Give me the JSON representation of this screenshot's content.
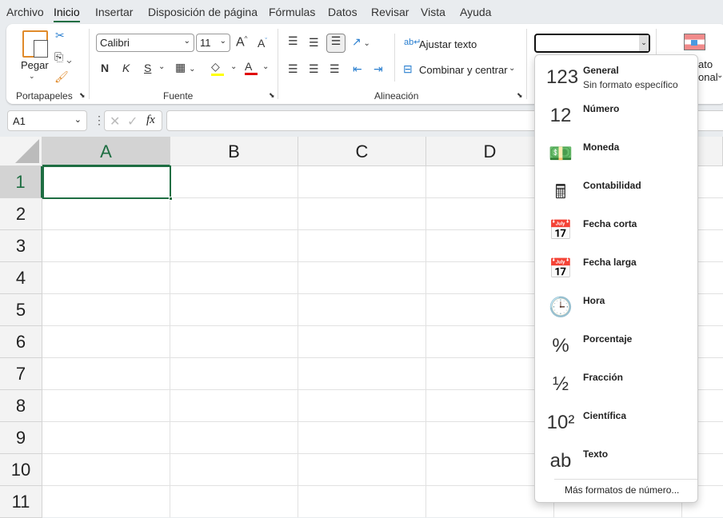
{
  "tabs": [
    "Archivo",
    "Inicio",
    "Insertar",
    "Disposición de página",
    "Fórmulas",
    "Datos",
    "Revisar",
    "Vista",
    "Ayuda"
  ],
  "active_tab": "Inicio",
  "clipboard": {
    "paste": "Pegar",
    "group": "Portapapeles"
  },
  "font": {
    "name": "Calibri",
    "size": "11",
    "bold": "N",
    "italic": "K",
    "underline": "S",
    "group": "Fuente",
    "fill_color": "#ffff00",
    "font_color": "#e00000"
  },
  "alignment": {
    "wrap": "Ajustar texto",
    "merge": "Combinar y centrar",
    "group": "Alineación"
  },
  "number_format": {
    "value": ""
  },
  "conditional": {
    "line1": "ato",
    "line2": "onal"
  },
  "formula_bar": {
    "name_box": "A1",
    "fx": "fx",
    "value": ""
  },
  "columns": [
    "A",
    "B",
    "C",
    "D"
  ],
  "rows": [
    "1",
    "2",
    "3",
    "4",
    "5",
    "6",
    "7",
    "8",
    "9",
    "10",
    "11"
  ],
  "selected_cell": "A1",
  "format_menu": {
    "items": [
      {
        "label": "General",
        "sub": "Sin formato específico",
        "icon": "clock-123-icon",
        "glyph": "123"
      },
      {
        "label": "Número",
        "icon": "number-icon",
        "glyph": "12"
      },
      {
        "label": "Moneda",
        "icon": "currency-icon",
        "glyph": "💵"
      },
      {
        "label": "Contabilidad",
        "icon": "accounting-icon",
        "glyph": "🖩"
      },
      {
        "label": "Fecha corta",
        "icon": "calendar-short-icon",
        "glyph": "📅"
      },
      {
        "label": "Fecha larga",
        "icon": "calendar-long-icon",
        "glyph": "📅"
      },
      {
        "label": "Hora",
        "icon": "clock-icon",
        "glyph": "🕒"
      },
      {
        "label": "Porcentaje",
        "icon": "percent-icon",
        "glyph": "%"
      },
      {
        "label": "Fracción",
        "icon": "fraction-icon",
        "glyph": "½"
      },
      {
        "label": "Científica",
        "icon": "scientific-icon",
        "glyph": "10²"
      },
      {
        "label": "Texto",
        "icon": "text-icon",
        "glyph": "ab"
      }
    ],
    "more": "Más formatos de número..."
  }
}
